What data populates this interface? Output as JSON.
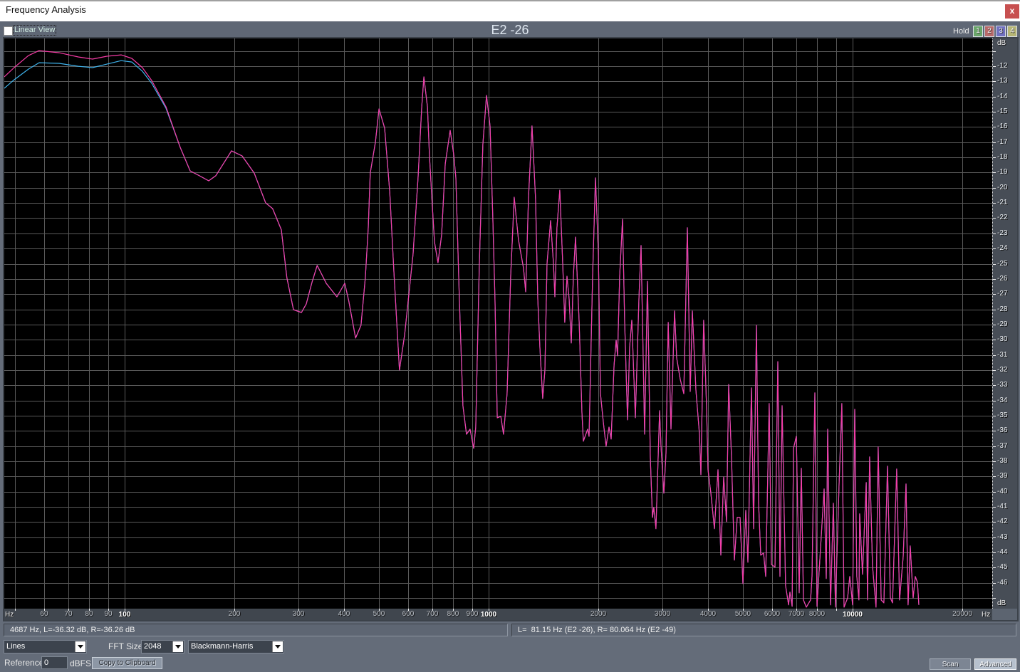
{
  "window": {
    "title": "Frequency Analysis",
    "close_label": "x"
  },
  "header": {
    "linear_view_label": "Linear View",
    "linear_view_checked": false,
    "note_title": "E2 -26",
    "hold_label": "Hold",
    "hold_buttons": [
      {
        "label": "1",
        "color": "#6aa56a"
      },
      {
        "label": "2",
        "color": "#b86a6a"
      },
      {
        "label": "3",
        "color": "#7070c0"
      },
      {
        "label": "4",
        "color": "#b5b575"
      }
    ]
  },
  "chart_data": {
    "type": "line",
    "title": "E2 -26",
    "xlabel": "Hz",
    "ylabel": "dB",
    "xscale": "log",
    "xlim": [
      46.7,
      24190
    ],
    "ylim": [
      -47.7,
      -10.17
    ],
    "grid": true,
    "x_gridlines": [
      50,
      60,
      70,
      80,
      90,
      100,
      200,
      300,
      400,
      500,
      600,
      700,
      800,
      900,
      1000,
      2000,
      3000,
      4000,
      5000,
      6000,
      7000,
      8000,
      9000,
      10000,
      20000
    ],
    "x_ticks": [
      {
        "value": 60,
        "label": "60"
      },
      {
        "value": 70,
        "label": "70"
      },
      {
        "value": 80,
        "label": "80"
      },
      {
        "value": 90,
        "label": "90"
      },
      {
        "value": 100,
        "label": "100",
        "major": true
      },
      {
        "value": 200,
        "label": "200"
      },
      {
        "value": 300,
        "label": "300"
      },
      {
        "value": 400,
        "label": "400"
      },
      {
        "value": 500,
        "label": "500"
      },
      {
        "value": 600,
        "label": "600"
      },
      {
        "value": 700,
        "label": "700"
      },
      {
        "value": 800,
        "label": "800"
      },
      {
        "value": 900,
        "label": "900"
      },
      {
        "value": 1000,
        "label": "1000",
        "major": true
      },
      {
        "value": 2000,
        "label": "2000"
      },
      {
        "value": 3000,
        "label": "3000"
      },
      {
        "value": 4000,
        "label": "4000"
      },
      {
        "value": 5000,
        "label": "5000"
      },
      {
        "value": 6000,
        "label": "6000"
      },
      {
        "value": 7000,
        "label": "7000"
      },
      {
        "value": 8000,
        "label": "8000"
      },
      {
        "value": 10000,
        "label": "10000",
        "major": true
      },
      {
        "value": 20000,
        "label": "20000"
      }
    ],
    "y_gridlines_step": 1,
    "y_ticks": [
      -12,
      -13,
      -14,
      -15,
      -16,
      -17,
      -18,
      -19,
      -20,
      -21,
      -22,
      -23,
      -24,
      -25,
      -26,
      -27,
      -28,
      -29,
      -30,
      -31,
      -32,
      -33,
      -34,
      -35,
      -36,
      -37,
      -38,
      -39,
      -40,
      -41,
      -42,
      -43,
      -44,
      -45,
      -46
    ],
    "series": [
      {
        "name": "R",
        "color": "#3fb4ee",
        "matches_L_above_hz": 130,
        "points": [
          [
            46.7,
            -13.45
          ],
          [
            49.7,
            -12.89
          ],
          [
            54.4,
            -12.19
          ],
          [
            58.2,
            -11.77
          ],
          [
            66.1,
            -11.81
          ],
          [
            74.6,
            -12.0
          ],
          [
            81.6,
            -12.09
          ],
          [
            89.4,
            -11.86
          ],
          [
            97.8,
            -11.63
          ],
          [
            104.6,
            -11.72
          ],
          [
            111.9,
            -12.33
          ],
          [
            118.7,
            -13.12
          ],
          [
            129.9,
            -14.76
          ]
        ]
      },
      {
        "name": "L",
        "color": "#f53ba5",
        "points": [
          [
            46.7,
            -12.7
          ],
          [
            49.7,
            -12.09
          ],
          [
            54.4,
            -11.3
          ],
          [
            58.2,
            -10.97
          ],
          [
            66.1,
            -11.11
          ],
          [
            74.6,
            -11.39
          ],
          [
            81.6,
            -11.53
          ],
          [
            89.4,
            -11.34
          ],
          [
            97.8,
            -11.25
          ],
          [
            104.6,
            -11.48
          ],
          [
            111.9,
            -12.09
          ],
          [
            118.7,
            -12.94
          ],
          [
            129.9,
            -14.67
          ],
          [
            142.1,
            -17.34
          ],
          [
            151.4,
            -18.89
          ],
          [
            160.5,
            -19.21
          ],
          [
            170.2,
            -19.54
          ],
          [
            178,
            -19.21
          ],
          [
            196.6,
            -17.57
          ],
          [
            210.3,
            -17.9
          ],
          [
            227,
            -19.03
          ],
          [
            244,
            -20.99
          ],
          [
            255,
            -21.37
          ],
          [
            269.5,
            -22.77
          ],
          [
            279,
            -25.91
          ],
          [
            291,
            -28.02
          ],
          [
            306,
            -28.21
          ],
          [
            315.5,
            -27.64
          ],
          [
            327,
            -26.24
          ],
          [
            338,
            -25.11
          ],
          [
            350,
            -25.82
          ],
          [
            358,
            -26.29
          ],
          [
            383,
            -27.18
          ],
          [
            402.5,
            -26.29
          ],
          [
            413,
            -27.46
          ],
          [
            431,
            -29.89
          ],
          [
            446,
            -29.05
          ],
          [
            458.5,
            -25.91
          ],
          [
            467,
            -22.63
          ],
          [
            473,
            -19.03
          ],
          [
            488.5,
            -17.01
          ],
          [
            500,
            -14.81
          ],
          [
            518,
            -16.07
          ],
          [
            535,
            -20.29
          ],
          [
            549,
            -25.44
          ],
          [
            569,
            -32.0
          ],
          [
            588,
            -29.66
          ],
          [
            620,
            -24.37
          ],
          [
            640,
            -19.35
          ],
          [
            655,
            -14.67
          ],
          [
            664,
            -12.7
          ],
          [
            679,
            -14.67
          ],
          [
            688,
            -17.95
          ],
          [
            700.5,
            -21.23
          ],
          [
            710,
            -23.57
          ],
          [
            726,
            -24.93
          ],
          [
            743,
            -23.1
          ],
          [
            760,
            -18.42
          ],
          [
            784,
            -16.22
          ],
          [
            802,
            -17.81
          ],
          [
            813,
            -19.35
          ],
          [
            831,
            -27.32
          ],
          [
            850,
            -34.34
          ],
          [
            869.5,
            -36.22
          ],
          [
            889,
            -35.89
          ],
          [
            910,
            -37.15
          ],
          [
            922,
            -35.75
          ],
          [
            943,
            -25.11
          ],
          [
            964.5,
            -17.15
          ],
          [
            986.5,
            -13.92
          ],
          [
            1009,
            -15.93
          ],
          [
            1027,
            -22.02
          ],
          [
            1041,
            -27.32
          ],
          [
            1056,
            -35.14
          ],
          [
            1080,
            -35.04
          ],
          [
            1099,
            -36.22
          ],
          [
            1124,
            -33.55
          ],
          [
            1150,
            -25.77
          ],
          [
            1176,
            -20.62
          ],
          [
            1208,
            -23.43
          ],
          [
            1247,
            -25.3
          ],
          [
            1264,
            -26.85
          ],
          [
            1287,
            -20.62
          ],
          [
            1316,
            -15.93
          ],
          [
            1346,
            -20.76
          ],
          [
            1365,
            -27.32
          ],
          [
            1383,
            -30.45
          ],
          [
            1408,
            -33.87
          ],
          [
            1428,
            -32.0
          ],
          [
            1447,
            -24.97
          ],
          [
            1480,
            -22.16
          ],
          [
            1507,
            -24.97
          ],
          [
            1521,
            -27.18
          ],
          [
            1541,
            -22.63
          ],
          [
            1569,
            -20.15
          ],
          [
            1598,
            -24.97
          ],
          [
            1619,
            -28.86
          ],
          [
            1642,
            -25.82
          ],
          [
            1664,
            -27.32
          ],
          [
            1687,
            -30.22
          ],
          [
            1710,
            -25.77
          ],
          [
            1733,
            -23.24
          ],
          [
            1773,
            -28.86
          ],
          [
            1805,
            -34.81
          ],
          [
            1821,
            -36.68
          ],
          [
            1871,
            -35.89
          ],
          [
            1888,
            -36.36
          ],
          [
            1931,
            -25.77
          ],
          [
            1966,
            -19.35
          ],
          [
            2002,
            -24.18
          ],
          [
            2029,
            -33.55
          ],
          [
            2066,
            -35.42
          ],
          [
            2103,
            -37.01
          ],
          [
            2142,
            -35.75
          ],
          [
            2171,
            -36.54
          ],
          [
            2211,
            -31.67
          ],
          [
            2241,
            -30.03
          ],
          [
            2261,
            -31.06
          ],
          [
            2292,
            -25.77
          ],
          [
            2333,
            -22.07
          ],
          [
            2365,
            -28.86
          ],
          [
            2408,
            -35.28
          ],
          [
            2441,
            -30.45
          ],
          [
            2474,
            -28.72
          ],
          [
            2530,
            -35.14
          ],
          [
            2588,
            -27.32
          ],
          [
            2623,
            -23.8
          ],
          [
            2683,
            -36.22
          ],
          [
            2732,
            -26.15
          ],
          [
            2781,
            -37.76
          ],
          [
            2819,
            -41.7
          ],
          [
            2844,
            -41.04
          ],
          [
            2883,
            -42.44
          ],
          [
            2949,
            -34.67
          ],
          [
            2976,
            -37.01
          ],
          [
            3030,
            -40.1
          ],
          [
            3072,
            -37.48
          ],
          [
            3114,
            -28.86
          ],
          [
            3170,
            -35.89
          ],
          [
            3242,
            -28.11
          ],
          [
            3286,
            -31.2
          ],
          [
            3361,
            -32.61
          ],
          [
            3438,
            -33.55
          ],
          [
            3516,
            -22.63
          ],
          [
            3580,
            -33.41
          ],
          [
            3629,
            -28.11
          ],
          [
            3711,
            -33.31
          ],
          [
            3796,
            -36.22
          ],
          [
            3830,
            -38.89
          ],
          [
            3899,
            -28.72
          ],
          [
            3970,
            -34.34
          ],
          [
            4006,
            -38.56
          ],
          [
            4080,
            -40.1
          ],
          [
            4173,
            -42.44
          ],
          [
            4268,
            -38.56
          ],
          [
            4345,
            -44.18
          ],
          [
            4425,
            -39.03
          ],
          [
            4505,
            -41.98
          ],
          [
            4566,
            -32.94
          ],
          [
            4649,
            -37.76
          ],
          [
            4734,
            -44.51
          ],
          [
            4819,
            -41.7
          ],
          [
            4907,
            -41.7
          ],
          [
            4996,
            -46.05
          ],
          [
            5087,
            -41.23
          ],
          [
            5156,
            -44.65
          ],
          [
            5274,
            -33.17
          ],
          [
            5346,
            -42.44
          ],
          [
            5443,
            -29.05
          ],
          [
            5517,
            -40.76
          ],
          [
            5593,
            -44.18
          ],
          [
            5694,
            -44.04
          ],
          [
            5771,
            -45.58
          ],
          [
            5902,
            -34.2
          ],
          [
            5983,
            -44.79
          ],
          [
            6119,
            -44.97
          ],
          [
            6231,
            -31.44
          ],
          [
            6316,
            -45.58
          ],
          [
            6402,
            -34.34
          ],
          [
            6546,
            -46.19
          ],
          [
            6669,
            -47.45
          ],
          [
            6728,
            -46.61
          ],
          [
            6821,
            -47.55
          ],
          [
            6882,
            -37.15
          ],
          [
            7007,
            -36.36
          ],
          [
            7134,
            -46.66
          ],
          [
            7231,
            -38.46
          ],
          [
            7330,
            -47.13
          ],
          [
            7463,
            -47.6
          ],
          [
            7667,
            -47.13
          ],
          [
            7737,
            -45.58
          ],
          [
            7878,
            -33.5
          ],
          [
            7985,
            -47.55
          ],
          [
            8352,
            -39.82
          ],
          [
            8466,
            -45.72
          ],
          [
            8542,
            -35.89
          ],
          [
            8697,
            -47.45
          ],
          [
            8856,
            -40.76
          ],
          [
            8974,
            -47.6
          ],
          [
            9179,
            -39.49
          ],
          [
            9345,
            -34.2
          ],
          [
            9474,
            -47.6
          ],
          [
            9690,
            -46.99
          ],
          [
            9821,
            -45.58
          ],
          [
            10000,
            -47.45
          ],
          [
            10140,
            -34.58
          ],
          [
            10270,
            -45.58
          ],
          [
            10410,
            -47.13
          ],
          [
            10460,
            -41.46
          ],
          [
            10650,
            -45.44
          ],
          [
            10900,
            -39.4
          ],
          [
            10990,
            -47.13
          ],
          [
            11140,
            -37.71
          ],
          [
            11340,
            -44.88
          ],
          [
            11600,
            -47.6
          ],
          [
            11760,
            -37.06
          ],
          [
            11980,
            -47.13
          ],
          [
            12190,
            -47.32
          ],
          [
            12470,
            -38.32
          ],
          [
            12700,
            -46.99
          ],
          [
            12870,
            -47.32
          ],
          [
            13220,
            -38.51
          ],
          [
            13460,
            -47.13
          ],
          [
            13770,
            -44.27
          ],
          [
            14020,
            -39.49
          ],
          [
            14210,
            -47.45
          ],
          [
            14400,
            -43.57
          ],
          [
            14670,
            -46.99
          ],
          [
            14870,
            -45.58
          ],
          [
            15070,
            -45.96
          ],
          [
            15210,
            -47.45
          ]
        ]
      }
    ]
  },
  "status": {
    "cursor_readout": "4687 Hz, L=-36.32 dB, R=-36.26 dB",
    "pitch_readout": "L=  81.15 Hz (E2 -26), R= 80.064 Hz (E2 -49)"
  },
  "controls": {
    "display_mode": "Lines",
    "fft_size_label": "FFT Size",
    "fft_size": "2048",
    "window_function": "Blackmann-Harris",
    "reference_label": "Reference",
    "reference_value": "0",
    "reference_unit": "dBFS",
    "copy_button": "Copy to Clipboard",
    "scan_button": "Scan",
    "advanced_button": "Advanced"
  }
}
